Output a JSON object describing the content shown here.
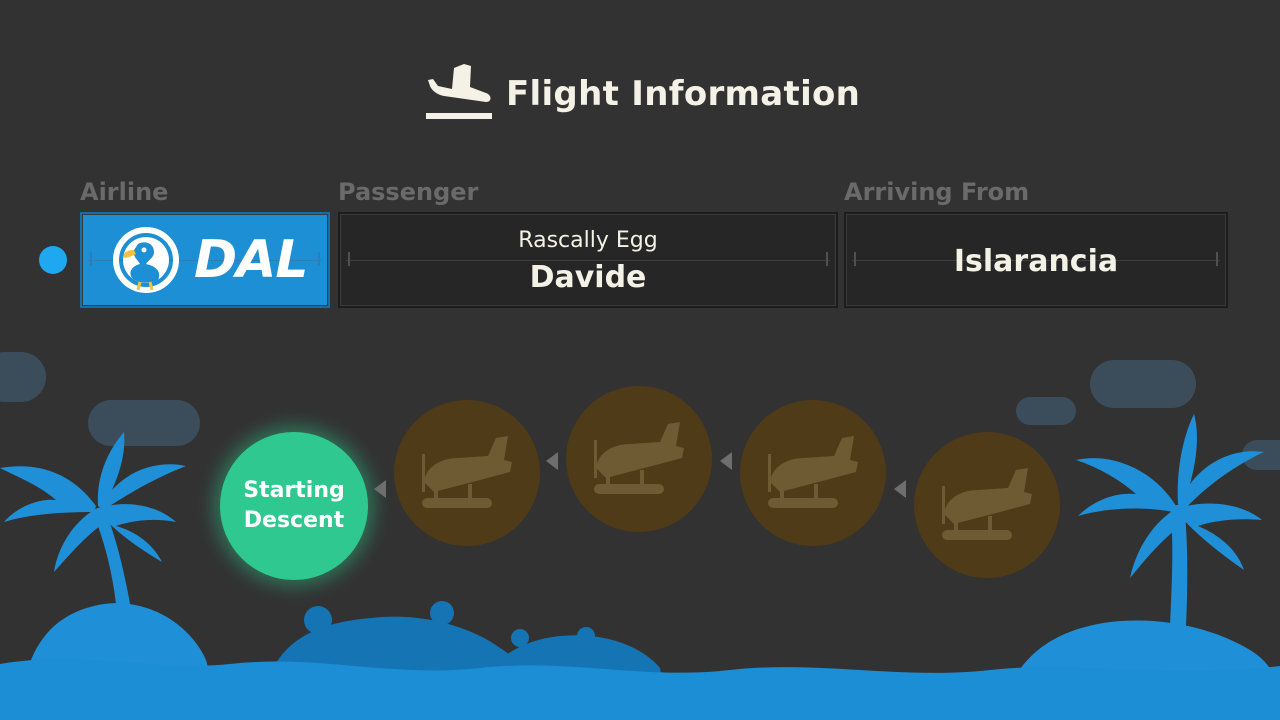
{
  "header": {
    "title": "Flight Information",
    "icon": "plane-landing-icon"
  },
  "labels": {
    "airline": "Airline",
    "passenger": "Passenger",
    "arriving_from": "Arriving From"
  },
  "airline": {
    "logo_text": "DAL",
    "logo_icon": "dodo-icon",
    "color": "#1d8fd4"
  },
  "passenger": {
    "title": "Rascally Egg",
    "name": "Davide"
  },
  "arriving_from": {
    "value": "Islarancia"
  },
  "progress": {
    "current_stage_label": "Starting Descent",
    "current_color": "#2fc890",
    "pending_stage_icon": "seaplane-icon",
    "pending_stages": 4
  },
  "status_dot_color": "#1fa7ef"
}
